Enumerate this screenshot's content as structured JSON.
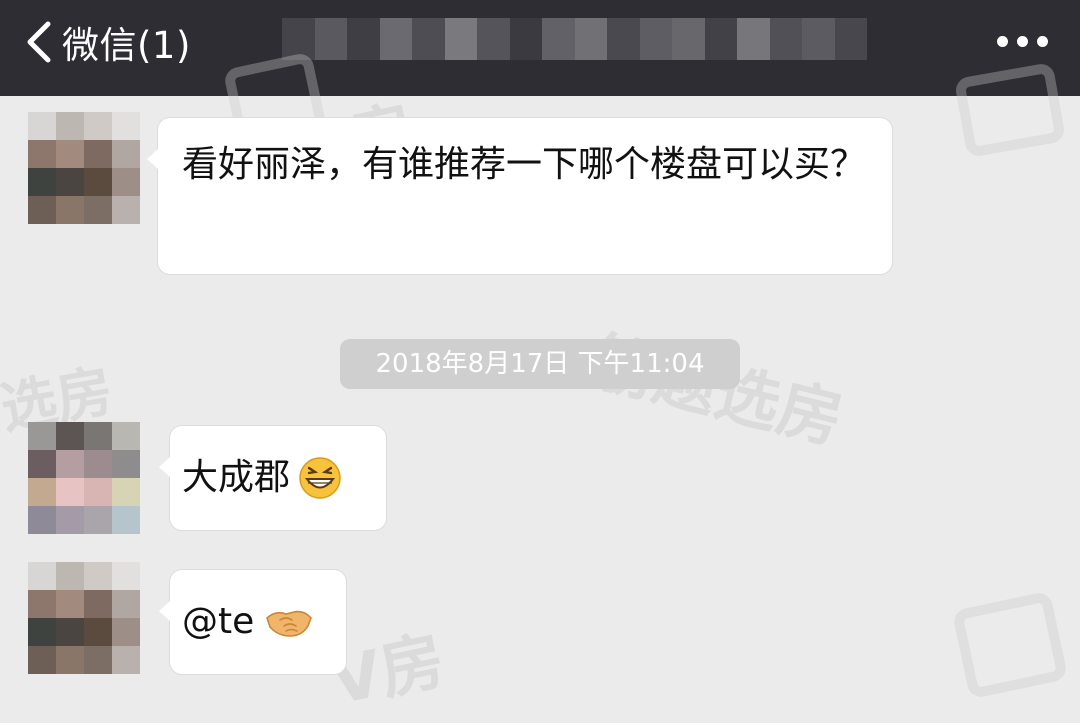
{
  "header": {
    "back_label": "微信(1)",
    "chat_title": ""
  },
  "messages": [
    {
      "text": "看好丽泽，有谁推荐一下哪个楼盘可以买？"
    },
    {
      "text": "大成郡",
      "emoji": "grinning-emoji"
    },
    {
      "text": "@te",
      "emoji": "handshake-emoji"
    }
  ],
  "timestamp": "2018年8月17日 下午11:04",
  "watermarks": [
    "V房",
    "筋题选房",
    "选房"
  ],
  "colors": {
    "header_bg": "#2e2d33",
    "chat_bg": "#ebebeb",
    "bubble_bg": "#ffffff",
    "timestamp_bg": "#cfcfcf"
  }
}
